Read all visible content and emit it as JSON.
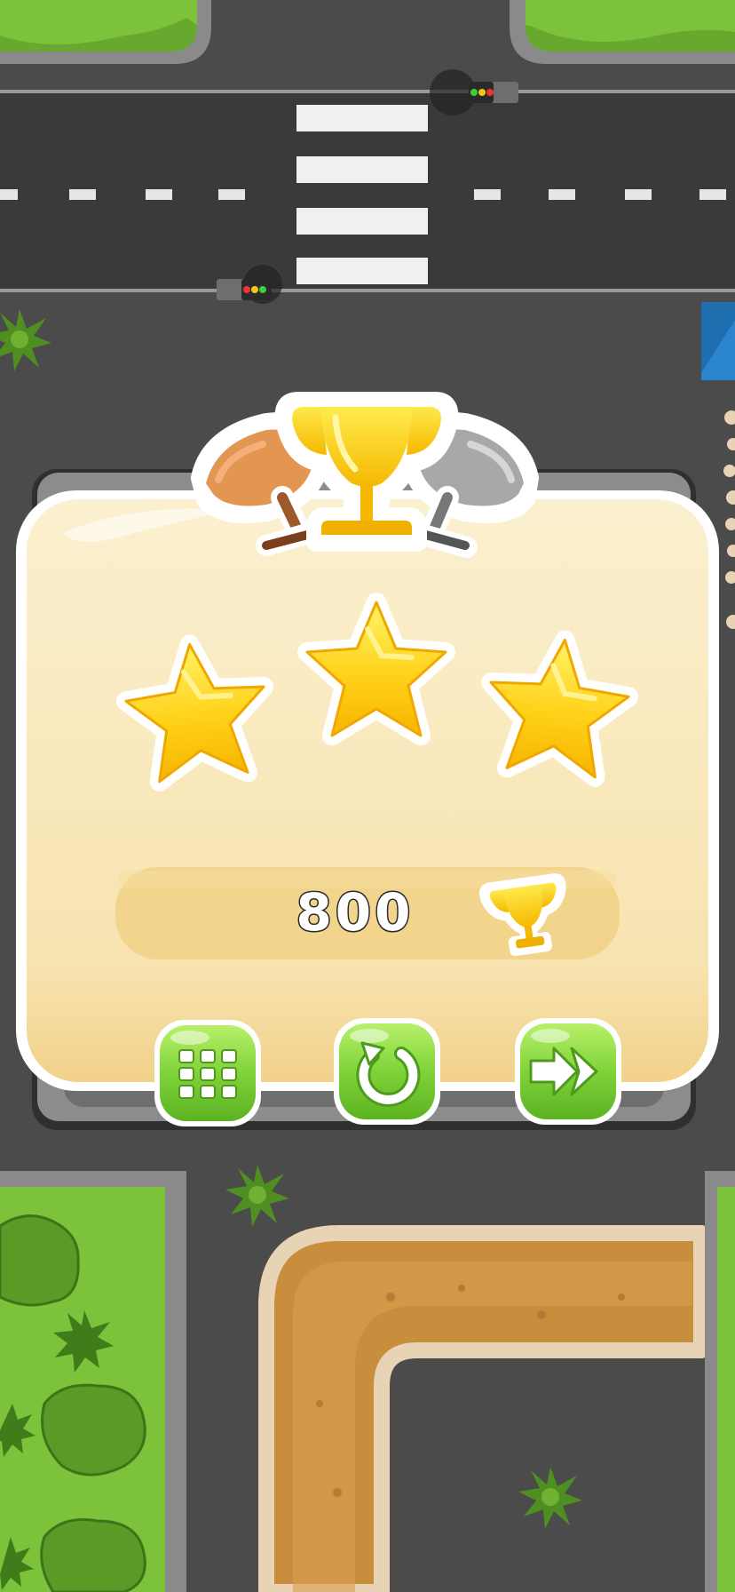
{
  "game": {
    "screen": "level-complete",
    "stars_earned": 3,
    "stars_total": 3,
    "score": "800",
    "trophies": [
      "bronze-trophy",
      "gold-trophy",
      "silver-trophy"
    ],
    "score_icon": "trophy-icon"
  },
  "buttons": [
    {
      "name": "level-select-button",
      "icon": "grid-icon"
    },
    {
      "name": "restart-button",
      "icon": "restart-icon"
    },
    {
      "name": "next-level-button",
      "icon": "fast-forward-icon"
    }
  ],
  "colors": {
    "panel_cream": "#f7e3b0",
    "panel_border": "#ffffff",
    "star_yellow": "#ffd21a",
    "button_green": "#7fd33a",
    "road": "#4a4a4a",
    "grass": "#7cc23a",
    "dirt": "#c98d3e"
  }
}
